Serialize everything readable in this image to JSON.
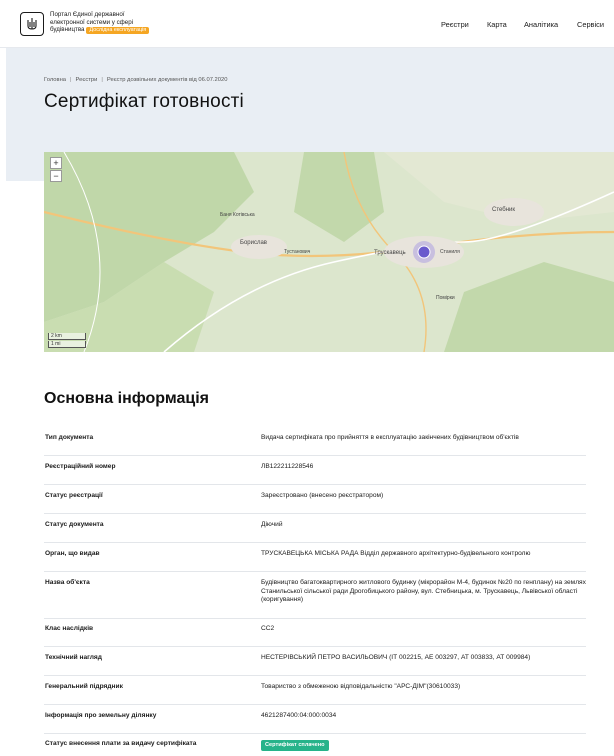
{
  "header": {
    "brand_line1": "Портал Єдиної державної",
    "brand_line2": "електронної системи у сфері",
    "brand_line3": "будівництва",
    "beta_badge": "Дослідна експлуатація",
    "nav": [
      "Реєстри",
      "Карта",
      "Аналітика",
      "Сервіси"
    ]
  },
  "breadcrumb": [
    "Головна",
    "Реєстри",
    "Реєстр дозвільних документів від 06.07.2020"
  ],
  "page_title": "Сертифікат готовності",
  "map": {
    "zoom_in": "+",
    "zoom_out": "−",
    "scale_km": "2 km",
    "scale_mi": "1 mi",
    "places": [
      "Борислав",
      "Трускавець",
      "Стебник",
      "Станиля",
      "Тустанович",
      "Баня Котівська",
      "Помірки"
    ]
  },
  "section_title": "Основна інформація",
  "rows": [
    {
      "label": "Тип документа",
      "value": "Видача сертифіката про прийняття в експлуатацію закінчених будівництвом об'єктів"
    },
    {
      "label": "Реєстраційний номер",
      "value": "ЛВ122211228546"
    },
    {
      "label": "Статус реєстрації",
      "value": "Зареєстровано (внесено реєстратором)"
    },
    {
      "label": "Статус документа",
      "value": "Діючий"
    },
    {
      "label": "Орган, що видав",
      "value": "ТРУСКАВЕЦЬКА МІСЬКА РАДА Відділ державного архітектурно-будівельного контролю"
    },
    {
      "label": "Назва об'єкта",
      "value": "Будівництво багатоквартирного житлового будинку (мікрорайон М-4, будинок №20 по генплану) на землях Станильської сільської ради Дрогобицького району, вул. Стебницька, м. Трускавець, Львівської області (коригування)"
    },
    {
      "label": "Клас наслідків",
      "value": "СС2"
    },
    {
      "label": "Технічний нагляд",
      "value": "НЕСТЕРІВСЬКИЙ ПЕТРО ВАСИЛЬОВИЧ (ІТ 002215, АЕ 003297, АТ 003833, АТ 009984)"
    },
    {
      "label": "Генеральний підрядник",
      "value": "Товариство з обмеженою відповідальністю \"АРС-ДІМ\"(30610033)"
    },
    {
      "label": "Інформація про земельну ділянку",
      "value": "4621287400:04:000:0034"
    },
    {
      "label": "Статус внесення плати за видачу сертифіката",
      "value": "Сертифікат сплачено"
    }
  ],
  "colors": {
    "accent_badge": "#f5a623",
    "paid_badge": "#27b38a",
    "hero_bg": "#e9eef4",
    "map_bg": "#d8e3c8",
    "marker": "#6a5acd"
  }
}
